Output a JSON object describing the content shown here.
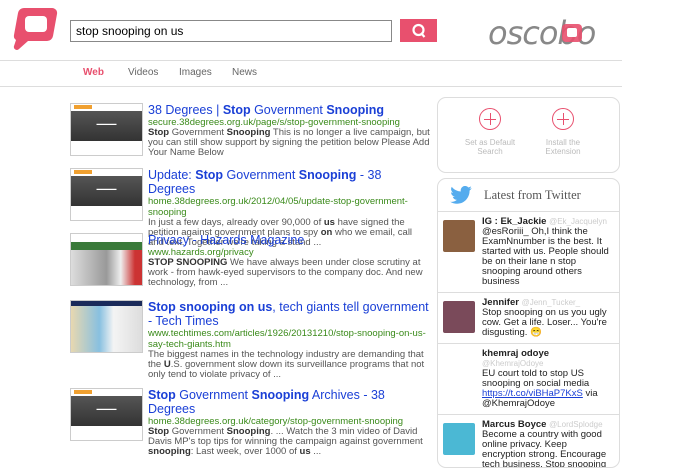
{
  "header": {
    "query": "stop snooping on us",
    "brand": "oscobo",
    "search_icon": "magnifier-icon",
    "logo_icon": "speech-bubble-logo-icon"
  },
  "tabs": [
    {
      "label": "Web",
      "active": true
    },
    {
      "label": "Videos"
    },
    {
      "label": "Images"
    },
    {
      "label": "News"
    }
  ],
  "results": [
    {
      "title": [
        {
          "t": "38 Degrees | "
        },
        {
          "t": "Stop",
          "b": 1
        },
        {
          "t": " Government "
        },
        {
          "t": "Snooping",
          "b": 1
        }
      ],
      "url": "secure.38degrees.org.uk/page/s/stop-government-snooping",
      "snippet": [
        {
          "t": "Stop",
          "b": 1
        },
        {
          "t": " Government "
        },
        {
          "t": "Snooping",
          "b": 1
        },
        {
          "t": " This is no longer a live campaign, but you can still show support by signing the petition below Please Add Your Name Below"
        }
      ],
      "thumb": "38degrees"
    },
    {
      "title": [
        {
          "t": "Update: "
        },
        {
          "t": "Stop",
          "b": 1
        },
        {
          "t": " Government "
        },
        {
          "t": "Snooping",
          "b": 1
        },
        {
          "t": " - 38 Degrees"
        }
      ],
      "url": "home.38degrees.org.uk/2012/04/05/update-stop-government-snooping",
      "snippet": [
        {
          "t": "In just a few days, already over 90,000 of "
        },
        {
          "t": "us",
          "b": 1
        },
        {
          "t": " have signed the petition against government plans to spy "
        },
        {
          "t": "on",
          "b": 1
        },
        {
          "t": " who we email, call and text. Together we're taking a stand ..."
        }
      ],
      "thumb": "38degrees"
    },
    {
      "title": [
        {
          "t": "Privacy - Hazards Magazine"
        }
      ],
      "url": "www.hazards.org/privacy",
      "snippet": [
        {
          "t": "STOP SNOOPING",
          "b": 1
        },
        {
          "t": " We have always been under close scrutiny at work - from hawk-eyed supervisors to the company doc. And new technology, from ..."
        }
      ],
      "thumb": "hazards"
    },
    {
      "title": [
        {
          "t": "Stop snooping on us",
          "b": 1
        },
        {
          "t": ", tech giants tell government - Tech Times"
        }
      ],
      "url": "www.techtimes.com/articles/1926/20131210/stop-snooping-on-us-say-tech-giants.htm",
      "snippet": [
        {
          "t": "The biggest names in the technology industry are demanding that the "
        },
        {
          "t": "U",
          "b": 1
        },
        {
          "t": ".S. government slow down its surveillance programs that not only tend to violate privacy of ..."
        }
      ],
      "thumb": "techtimes"
    },
    {
      "title": [
        {
          "t": "Stop",
          "b": 1
        },
        {
          "t": " Government "
        },
        {
          "t": "Snooping",
          "b": 1
        },
        {
          "t": " Archives - 38 Degrees"
        }
      ],
      "url": "home.38degrees.org.uk/category/stop-government-snooping",
      "snippet": [
        {
          "t": "Stop",
          "b": 1
        },
        {
          "t": " Government "
        },
        {
          "t": "Snooping",
          "b": 1
        },
        {
          "t": ". ... Watch the 3 min video of David Davis MP's top tips for winning the campaign against government "
        },
        {
          "t": "snooping",
          "b": 1
        },
        {
          "t": ": Last week, over 1000 of "
        },
        {
          "t": "us",
          "b": 1
        },
        {
          "t": " ..."
        }
      ],
      "thumb": "38degrees"
    }
  ],
  "actions": {
    "default": "Set as Default Search",
    "extension": "Install the Extension"
  },
  "twitter": {
    "title": "Latest from Twitter",
    "tweets": [
      {
        "name": "IG : Ek_Jackie",
        "handle": "@Ek_Jacquelyn",
        "text": "@esRoriii_ Oh,I think the ExamNnumber is the best. It started with us. People should be on their lane n stop snooping around others business",
        "avatar": "#8a6040"
      },
      {
        "name": "Jennifer",
        "handle": "@Jenn_Tucker_",
        "text": "Stop snooping on us you ugly cow. Get a life. Loser... You're disgusting. 😁",
        "avatar": "#7a4a5a"
      },
      {
        "name": "khemraj odoye",
        "handle": "@KhemrajOdoye",
        "text": "EU court told to stop US snooping on social media ",
        "link": "https://t.co/viBHaP7KxS",
        "after": " via @KhemrajOdoye",
        "avatar": "#fff"
      },
      {
        "name": "Marcus Boyce",
        "handle": "@LordSplodge",
        "text": "Become a country with good online privacy. Keep encryption strong. Encourage tech business. Stop snooping on us.",
        "avatar": "#4bb8d4"
      }
    ]
  }
}
